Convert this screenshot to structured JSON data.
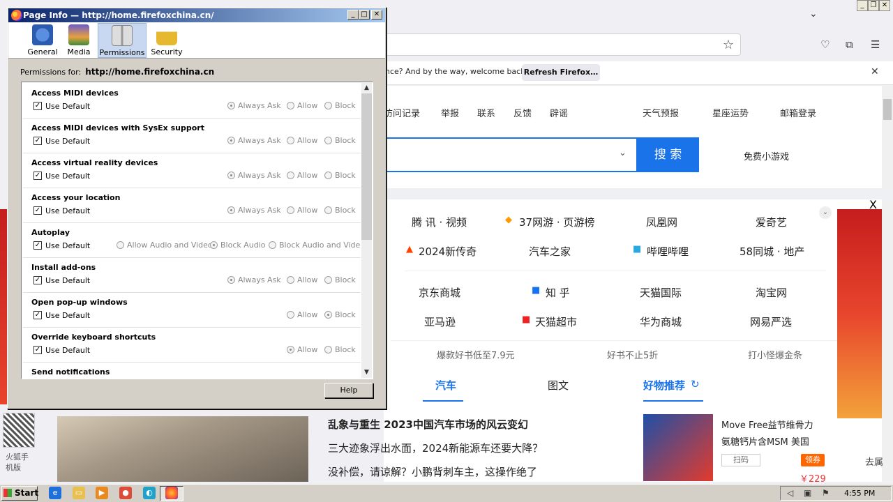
{
  "browser": {
    "notification_text": "nce? And by the way, welcome back!",
    "refresh_button": "Refresh Firefox…",
    "win_controls": [
      "_",
      "❐",
      "✕"
    ]
  },
  "page": {
    "top_nav": [
      "访问记录",
      "举报",
      "联系",
      "反馈",
      "辟谣"
    ],
    "top_right": [
      "天气预报",
      "星座运势",
      "邮箱登录"
    ],
    "search_button": "搜 索",
    "games_link": "免费小游戏",
    "links_row1": [
      "腾 讯 · 视频",
      "37网游 · 页游榜",
      "凤凰网",
      "爱奇艺"
    ],
    "links_row2": [
      "2024新传奇",
      "汽车之家",
      "哔哩哔哩",
      "58同城 · 地产"
    ],
    "links_row3": [
      "京东商城",
      "知 乎",
      "天猫国际",
      "淘宝网"
    ],
    "links_row4": [
      "亚马逊",
      "天猫超市",
      "华为商城",
      "网易严选"
    ],
    "coupons": [
      "爆款好书低至7.9元",
      "好书不止5折",
      "打小怪爆金条"
    ],
    "close_x": "X",
    "news_tabs": [
      "汽车",
      "图文"
    ],
    "rec_title": "好物推荐",
    "news": [
      "乱象与重生 2023中国汽车市场的风云变幻",
      "三大迹象浮出水面，2024新能源车还要大降？",
      "没补偿，请谅解？小鹏背刺车主，这操作绝了"
    ],
    "product_lines": [
      "Move Free益节维骨力",
      "氨糖钙片含MSM 美国"
    ],
    "scan_tag": "扫码",
    "rec_tag": "领券",
    "price": "￥229",
    "side_text": "去属",
    "left_qr_text": "火狐手机版"
  },
  "taskbar": {
    "start": "Start",
    "time": "4:55 PM"
  },
  "dialog": {
    "title": "Page Info — http://home.firefoxchina.cn/",
    "tools": [
      {
        "label": "General",
        "icon": "info-icon"
      },
      {
        "label": "Media",
        "icon": "media-icon"
      },
      {
        "label": "Permissions",
        "icon": "permissions-icon"
      },
      {
        "label": "Security",
        "icon": "lock-icon"
      }
    ],
    "permissions_for_label": "Permissions for:",
    "permissions_for_url": "http://home.firefoxchina.cn",
    "permissions": [
      {
        "title": "Access MIDI devices",
        "default": "Use Default",
        "options": [
          "Always Ask",
          "Allow",
          "Block"
        ],
        "selected": 0
      },
      {
        "title": "Access MIDI devices with SysEx support",
        "default": "Use Default",
        "options": [
          "Always Ask",
          "Allow",
          "Block"
        ],
        "selected": 0
      },
      {
        "title": "Access virtual reality devices",
        "default": "Use Default",
        "options": [
          "Always Ask",
          "Allow",
          "Block"
        ],
        "selected": 0
      },
      {
        "title": "Access your location",
        "default": "Use Default",
        "options": [
          "Always Ask",
          "Allow",
          "Block"
        ],
        "selected": 0
      },
      {
        "title": "Autoplay",
        "default": "Use Default",
        "options": [
          "Allow Audio and Video",
          "Block Audio",
          "Block Audio and Video"
        ],
        "selected": 1
      },
      {
        "title": "Install add-ons",
        "default": "Use Default",
        "options": [
          "Always Ask",
          "Allow",
          "Block"
        ],
        "selected": 0
      },
      {
        "title": "Open pop-up windows",
        "default": "Use Default",
        "options": [
          "Allow",
          "Block"
        ],
        "selected": 1
      },
      {
        "title": "Override keyboard shortcuts",
        "default": "Use Default",
        "options": [
          "Allow",
          "Block"
        ],
        "selected": 0
      },
      {
        "title": "Send notifications",
        "default": "",
        "options": [],
        "selected": -1
      }
    ],
    "help_button": "Help"
  }
}
